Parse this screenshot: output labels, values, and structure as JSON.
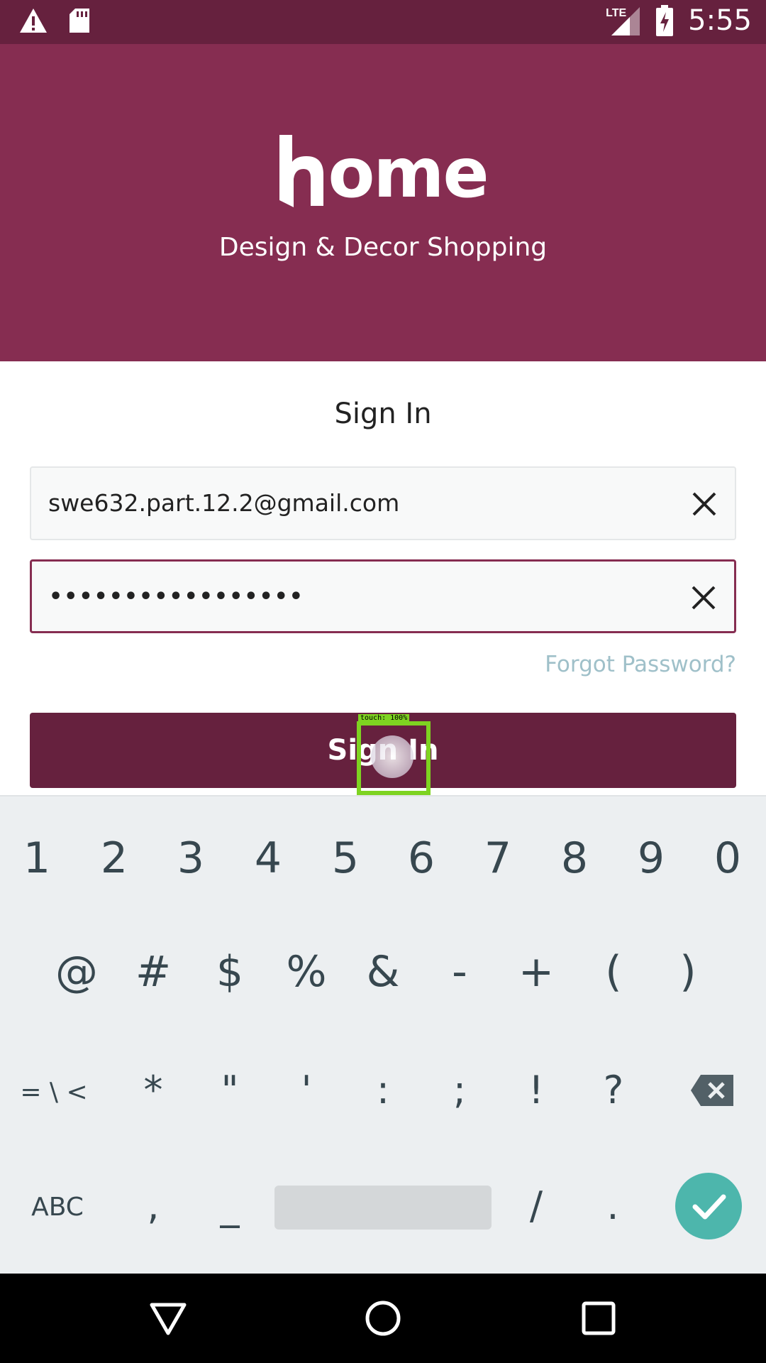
{
  "status_bar": {
    "network": "LTE",
    "time": "5:55",
    "icons": [
      "warning-icon",
      "sd-card-icon",
      "signal-icon",
      "battery-charging-icon"
    ]
  },
  "header": {
    "logo_text": "ome",
    "tagline": "Design & Decor Shopping",
    "background": "#862d51"
  },
  "form": {
    "title": "Sign In",
    "email_value": "swe632.part.12.2@gmail.com",
    "password_value": "•••••••••••••••••",
    "forgot_link": "Forgot Password?",
    "signin_button": "Sign In"
  },
  "touch_overlay": {
    "label": "touch: 100%"
  },
  "keyboard": {
    "row1": [
      "1",
      "2",
      "3",
      "4",
      "5",
      "6",
      "7",
      "8",
      "9",
      "0"
    ],
    "row2": [
      "@",
      "#",
      "$",
      "%",
      "&",
      "-",
      "+",
      "(",
      ")"
    ],
    "row3": [
      "= \\ <",
      "*",
      "\"",
      "'",
      ":",
      ";",
      "!",
      "?"
    ],
    "row4": [
      "ABC",
      ",",
      "_",
      "/",
      "."
    ],
    "icons": [
      "backspace-icon",
      "enter-check-icon"
    ],
    "accent": "#4db6ac"
  },
  "nav_bar": {
    "icons": [
      "back-icon",
      "home-icon",
      "recents-icon"
    ]
  },
  "colors": {
    "brand": "#862d51",
    "brand_dark": "#66213e",
    "link": "#9fc0c9"
  }
}
